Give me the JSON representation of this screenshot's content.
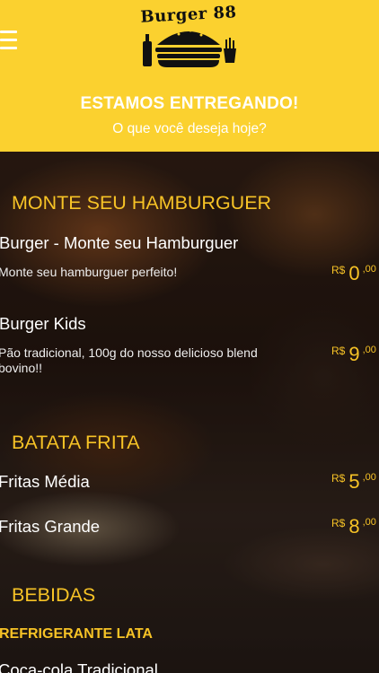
{
  "header": {
    "logo_text": "Burger 88",
    "title": "ESTAMOS ENTREGANDO!",
    "subtitle": "O que você deseja hoje?"
  },
  "colors": {
    "brand_yellow": "#fbd12f",
    "price_yellow": "#f7c326"
  },
  "icons": {
    "menu": "hamburger-menu-icon"
  },
  "menu": {
    "sections": [
      {
        "title": "MONTE SEU HAMBURGUER",
        "items": [
          {
            "name": "Burger - Monte seu Hamburguer",
            "description": "Monte seu hamburguer perfeito!",
            "currency": "R$",
            "price_int": "0",
            "price_dec": ",00"
          },
          {
            "name": "Burger Kids",
            "description": "Pão tradicional, 100g do nosso delicioso blend bovino!!",
            "currency": "R$",
            "price_int": "9",
            "price_dec": ",00"
          }
        ]
      },
      {
        "title": "BATATA FRITA",
        "items": [
          {
            "name": "Fritas Média",
            "currency": "R$",
            "price_int": "5",
            "price_dec": ",00"
          },
          {
            "name": "Fritas Grande",
            "currency": "R$",
            "price_int": "8",
            "price_dec": ",00"
          }
        ]
      },
      {
        "title": "BEBIDAS",
        "subsection": "REFRIGERANTE LATA",
        "items": [
          {
            "name": "Coca-cola Tradicional"
          }
        ]
      }
    ]
  }
}
